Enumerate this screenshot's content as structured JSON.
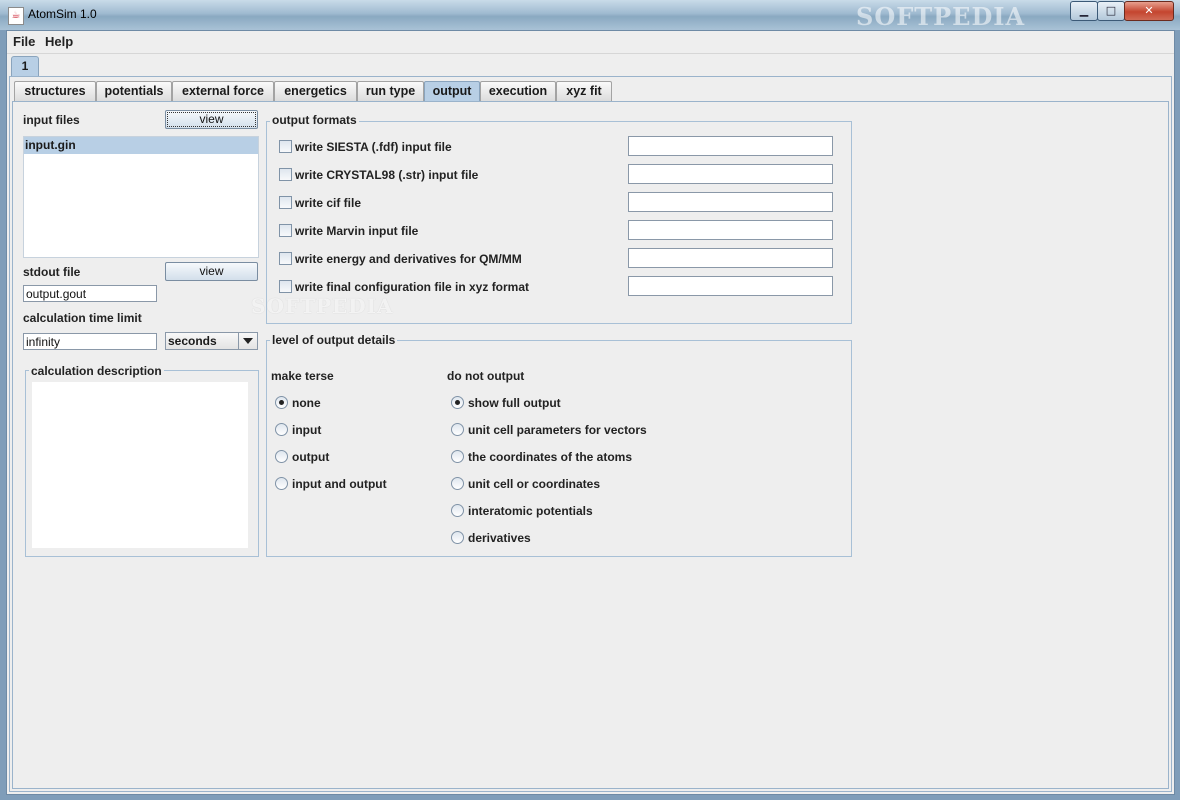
{
  "window": {
    "title": "AtomSim 1.0",
    "watermark": "SOFTPEDIA",
    "app_icon": "java-icon"
  },
  "menubar": {
    "items": [
      "File",
      "Help"
    ]
  },
  "outer_tabs": [
    "1"
  ],
  "tabs": [
    "structures",
    "potentials",
    "external force",
    "energetics",
    "run type",
    "output",
    "execution",
    "xyz fit"
  ],
  "active_tab": "output",
  "left": {
    "input_files_label": "input files",
    "view_label": "view",
    "input_files": [
      "input.gin"
    ],
    "stdout_label": "stdout file",
    "stdout_view_label": "view",
    "stdout_value": "output.gout",
    "time_limit_label": "calculation time limit",
    "time_limit_value": "infinity",
    "time_unit": "seconds",
    "description_label": "calculation description",
    "description_value": ""
  },
  "output_formats": {
    "title": "output formats",
    "items": [
      {
        "label": "write SIESTA (.fdf) input file",
        "checked": false,
        "value": ""
      },
      {
        "label": "write CRYSTAL98 (.str) input file",
        "checked": false,
        "value": ""
      },
      {
        "label": "write cif file",
        "checked": false,
        "value": ""
      },
      {
        "label": "write Marvin input file",
        "checked": false,
        "value": ""
      },
      {
        "label": "write energy and derivatives for QM/MM",
        "checked": false,
        "value": ""
      },
      {
        "label": "write final configuration file in xyz format",
        "checked": false,
        "value": ""
      }
    ]
  },
  "output_details": {
    "title": "level of output details",
    "make_terse_label": "make terse",
    "make_terse_options": [
      "none",
      "input",
      "output",
      "input and output"
    ],
    "make_terse_selected": "none",
    "do_not_output_label": "do not output",
    "do_not_output_options": [
      "show full output",
      "unit cell parameters for vectors",
      "the coordinates of the atoms",
      "unit cell or coordinates",
      "interatomic potentials",
      "derivatives"
    ],
    "do_not_output_selected": "show full output"
  },
  "colors": {
    "tab_active": "#b8cfe5",
    "panel_bg": "#eeeeee",
    "list_selection": "#b8cfe5"
  }
}
